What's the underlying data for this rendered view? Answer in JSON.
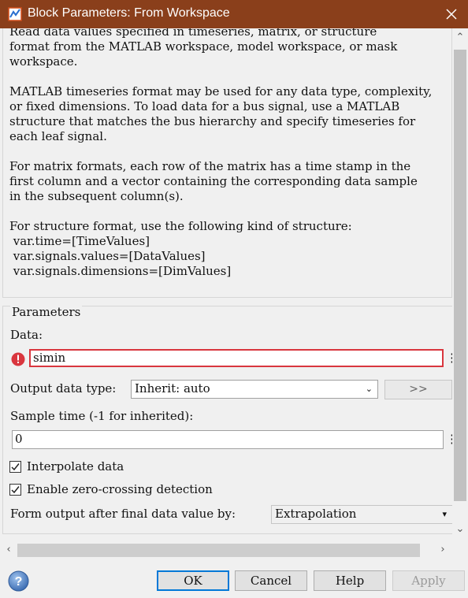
{
  "window": {
    "title": "Block Parameters: From Workspace"
  },
  "description": {
    "lines": [
      "Read data values specified in timeseries, matrix, or structure",
      "format from the MATLAB workspace, model workspace, or mask",
      "workspace.",
      "",
      "MATLAB timeseries format may be used for any data type, complexity,",
      "or fixed dimensions. To load data for a bus signal, use a MATLAB",
      "structure that matches the bus hierarchy and specify timeseries for",
      "each leaf signal.",
      "",
      "For matrix formats, each row of the matrix has a time stamp in the",
      "first column and a vector containing the corresponding data sample",
      "in the subsequent column(s).",
      "",
      "For structure format, use the following kind of structure:",
      " var.time=[TimeValues]",
      " var.signals.values=[DataValues]",
      " var.signals.dimensions=[DimValues]"
    ]
  },
  "params": {
    "legend": "Parameters",
    "data_label": "Data:",
    "data_value": "simin",
    "output_type_label": "Output data type:",
    "output_type_value": "Inherit: auto",
    "edit_button": ">>",
    "sample_time_label": "Sample time (-1 for inherited):",
    "sample_time_value": "0",
    "interpolate_label": "Interpolate data",
    "interpolate_checked": true,
    "zero_crossing_label": "Enable zero-crossing detection",
    "zero_crossing_checked": true,
    "form_output_label": "Form output after final data value by:",
    "form_output_value": "Extrapolation",
    "more_dots": "⋮"
  },
  "buttons": {
    "ok": "OK",
    "cancel": "Cancel",
    "help": "Help",
    "apply": "Apply"
  },
  "icons": {
    "title": "simulink-block-icon",
    "close": "close-icon",
    "error": "error-icon",
    "help": "help-icon",
    "chevron": "chevron-down-icon"
  },
  "colors": {
    "titlebar": "#8a3f1b",
    "error": "#d9363e",
    "default_button_border": "#0078d7"
  }
}
